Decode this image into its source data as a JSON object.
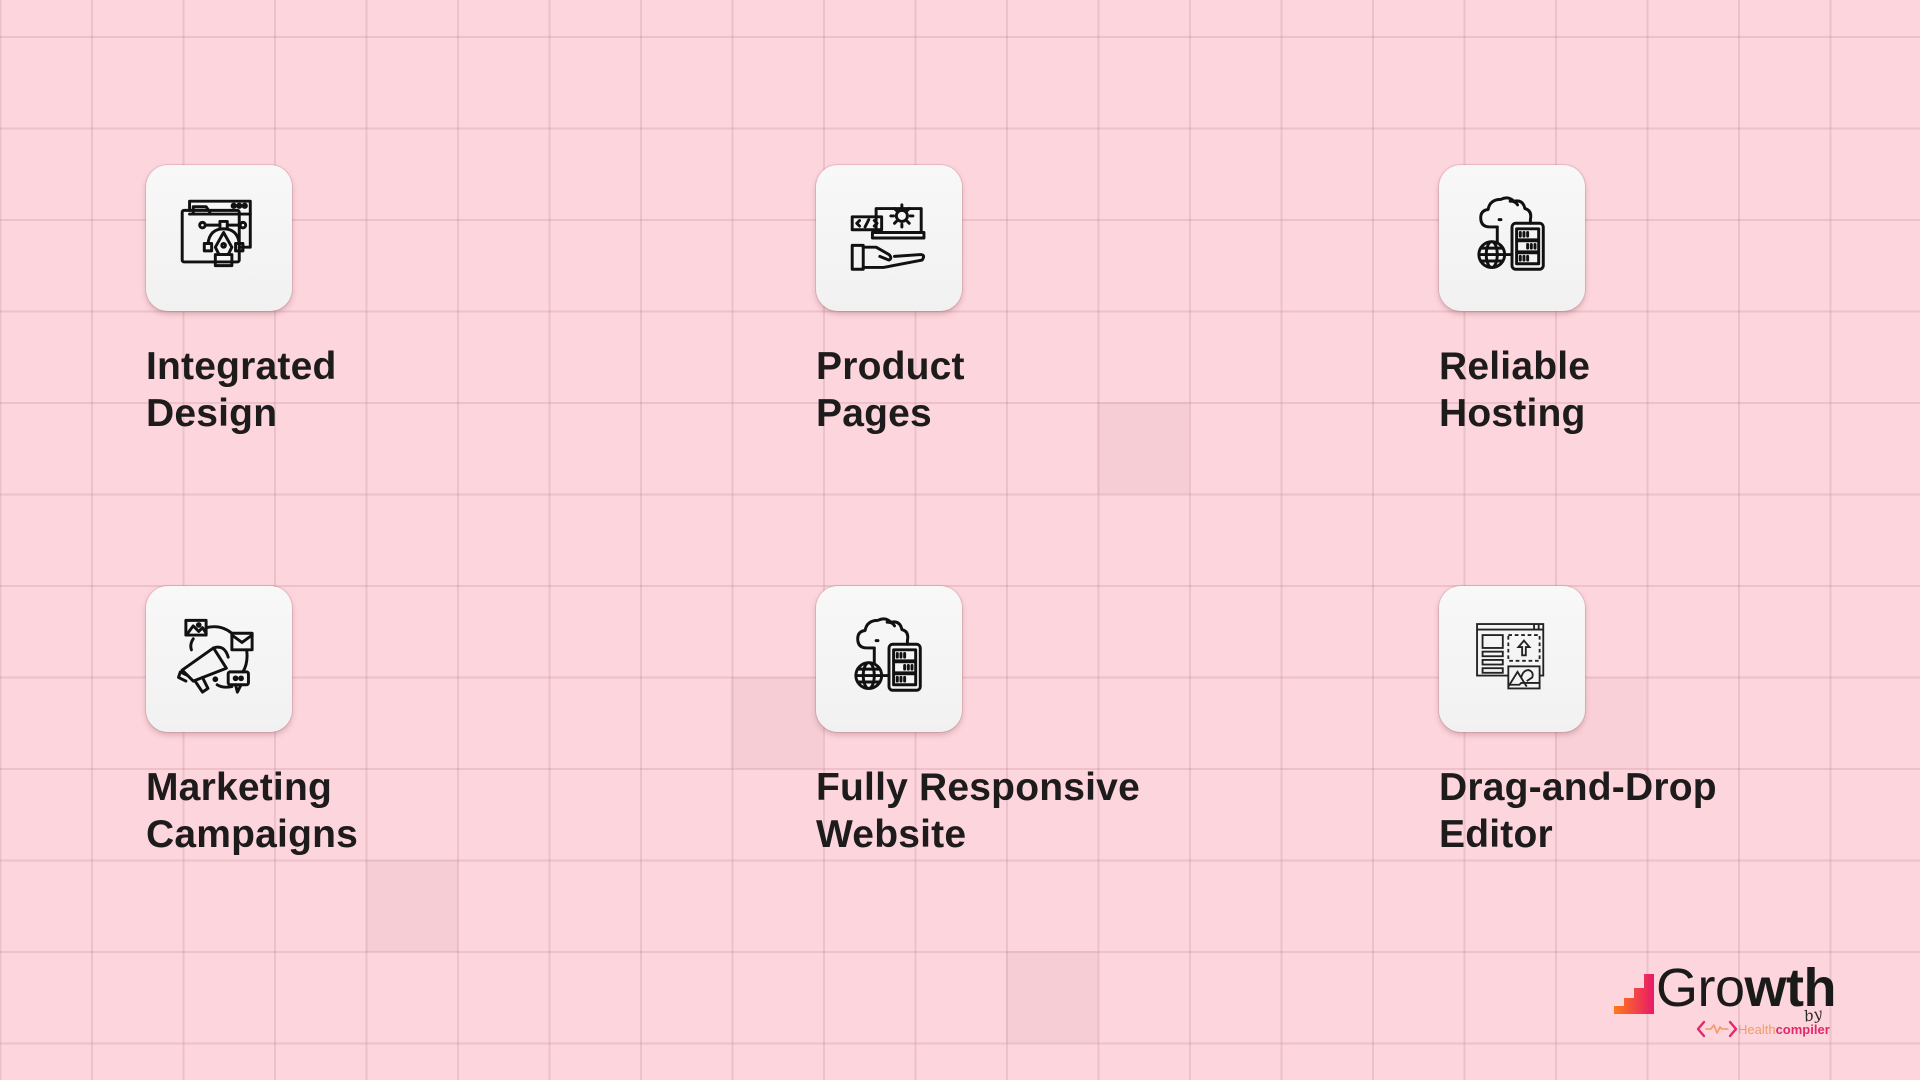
{
  "features": [
    {
      "id": "integrated-design",
      "icon": "design-tool-icon",
      "lines": [
        "Integrated",
        "Design"
      ]
    },
    {
      "id": "product-pages",
      "icon": "code-gear-hand-icon",
      "lines": [
        "Product",
        "Pages"
      ]
    },
    {
      "id": "reliable-hosting",
      "icon": "cloud-server-icon",
      "lines": [
        "Reliable",
        "Hosting"
      ]
    },
    {
      "id": "marketing-campaigns",
      "icon": "megaphone-icon",
      "lines": [
        "Marketing",
        "Campaigns"
      ]
    },
    {
      "id": "fully-responsive-website",
      "icon": "cloud-server-icon",
      "lines": [
        "Fully Responsive",
        "Website"
      ]
    },
    {
      "id": "drag-and-drop-editor",
      "icon": "drag-drop-layout-icon",
      "lines": [
        "Drag-and-Drop",
        "Editor"
      ]
    }
  ],
  "logo": {
    "word_thin": "Gro",
    "word_bold": "wth",
    "by": "by",
    "company_part1": "Health",
    "company_part2": "compiler"
  },
  "colors": {
    "background": "#fdd5dc",
    "text": "#1d1b1c",
    "logo_gradient_start": "#ff7a1a",
    "logo_gradient_end": "#e8196a",
    "company_accent": "#e5266a",
    "company_secondary": "#f39a6a"
  }
}
